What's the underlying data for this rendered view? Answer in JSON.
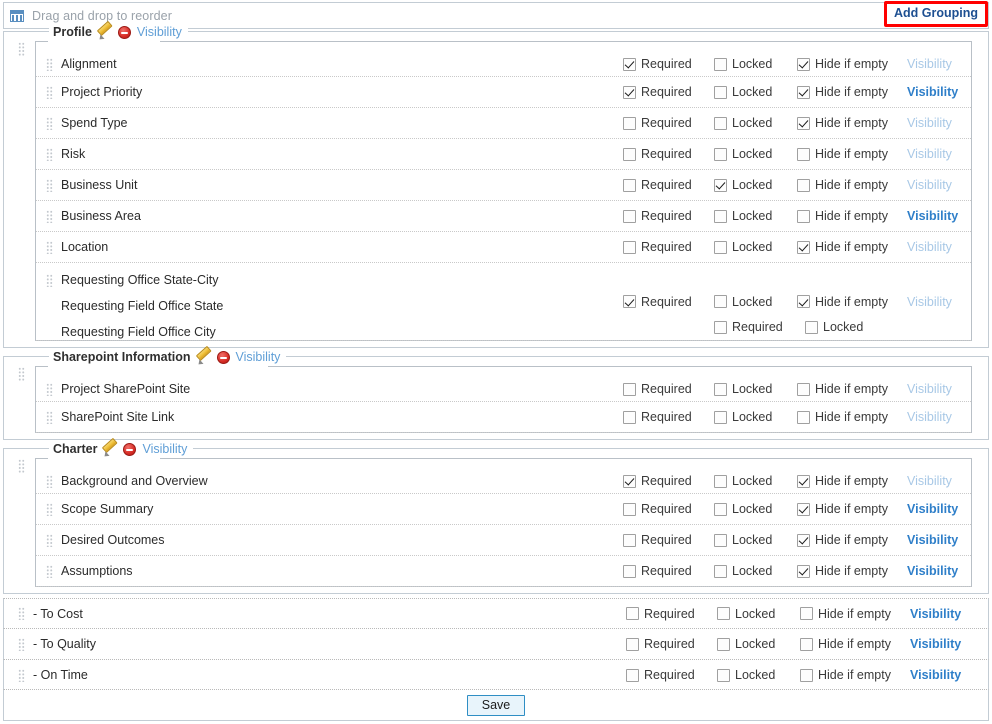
{
  "header": {
    "icon": "grid-table-icon",
    "drag_hint": "Drag and drop to reorder",
    "add_grouping_label": "Add Grouping",
    "highlight_color": "#ff0000"
  },
  "labels": {
    "required": "Required",
    "locked": "Locked",
    "hide_if_empty": "Hide if empty",
    "visibility": "Visibility",
    "save": "Save"
  },
  "icons": {
    "edit": "pencil-icon",
    "delete": "delete-circle-icon",
    "drag": "drag-handle-icon"
  },
  "colors": {
    "link_active": "#2f7fc9",
    "link_muted": "#a8c8e6",
    "group_legend_link": "#5f9ed6",
    "panel_border": "#c3ccd4",
    "save_border": "#2f8ec4",
    "save_bg": "#e8f4fb"
  },
  "groups": [
    {
      "name": "Profile",
      "visibility_label": "Visibility",
      "rows": [
        {
          "label": "Alignment",
          "required": true,
          "locked": false,
          "hide_if_empty": true,
          "visibility_state": "muted"
        },
        {
          "label": "Project Priority",
          "required": true,
          "locked": false,
          "hide_if_empty": true,
          "visibility_state": "active"
        },
        {
          "label": "Spend Type",
          "required": false,
          "locked": false,
          "hide_if_empty": true,
          "visibility_state": "muted"
        },
        {
          "label": "Risk",
          "required": false,
          "locked": false,
          "hide_if_empty": false,
          "visibility_state": "muted"
        },
        {
          "label": "Business Unit",
          "required": false,
          "locked": true,
          "hide_if_empty": false,
          "visibility_state": "muted"
        },
        {
          "label": "Business Area",
          "required": false,
          "locked": false,
          "hide_if_empty": false,
          "visibility_state": "active"
        },
        {
          "label": "Location",
          "required": false,
          "locked": false,
          "hide_if_empty": true,
          "visibility_state": "muted"
        }
      ],
      "composite_row": {
        "labels": [
          "Requesting Office State-City",
          "Requesting Field Office State",
          "Requesting Field Office City"
        ],
        "state_controls": {
          "required": true,
          "locked": false,
          "hide_if_empty": true,
          "visibility_state": "muted"
        },
        "city_controls": {
          "required": false,
          "locked": false
        }
      }
    },
    {
      "name": "Sharepoint Information",
      "visibility_label": "Visibility",
      "rows": [
        {
          "label": "Project SharePoint Site",
          "required": false,
          "locked": false,
          "hide_if_empty": false,
          "visibility_state": "muted"
        },
        {
          "label": "SharePoint Site Link",
          "required": false,
          "locked": false,
          "hide_if_empty": false,
          "visibility_state": "muted"
        }
      ]
    },
    {
      "name": "Charter",
      "visibility_label": "Visibility",
      "rows": [
        {
          "label": "Background and Overview",
          "required": true,
          "locked": false,
          "hide_if_empty": true,
          "visibility_state": "muted"
        },
        {
          "label": "Scope Summary",
          "required": false,
          "locked": false,
          "hide_if_empty": true,
          "visibility_state": "active"
        },
        {
          "label": "Desired Outcomes",
          "required": false,
          "locked": false,
          "hide_if_empty": true,
          "visibility_state": "active"
        },
        {
          "label": "Assumptions",
          "required": false,
          "locked": false,
          "hide_if_empty": true,
          "visibility_state": "active"
        }
      ]
    }
  ],
  "ungrouped_rows": [
    {
      "label": "- To Cost",
      "required": false,
      "locked": false,
      "hide_if_empty": false,
      "visibility_state": "active"
    },
    {
      "label": "- To Quality",
      "required": false,
      "locked": false,
      "hide_if_empty": false,
      "visibility_state": "active"
    },
    {
      "label": "- On Time",
      "required": false,
      "locked": false,
      "hide_if_empty": false,
      "visibility_state": "active"
    }
  ]
}
